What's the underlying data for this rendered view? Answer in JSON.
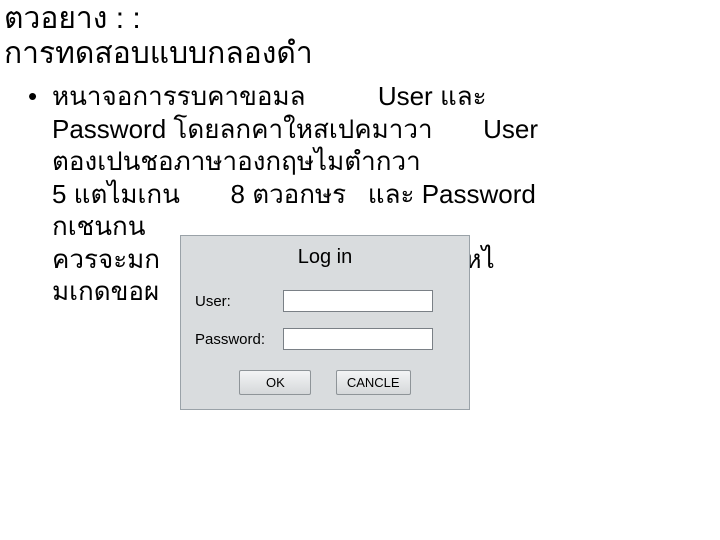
{
  "title": {
    "line1": "ตวอยาง   : :",
    "line2": "การทดสอบแบบกลองดำ"
  },
  "bullet": {
    "line1": "หนาจอการรบคาขอมล          User และ",
    "line2": "Password โดยลกคาใหสเปคมาวา       User",
    "line3": "ตองเปนชอภาษาองกฤษไมตำกวา",
    "line4": "5 แตไมเกน       8 ตวอกษร   และ Password",
    "line5": "กเชนกน",
    "line6": "ควรจะมก                                    ทำใหไ",
    "line7": "มเกดขอผ"
  },
  "login": {
    "title": "Log in",
    "user_label": "User:",
    "password_label": "Password:",
    "ok_label": "OK",
    "cancel_label": "CANCLE"
  }
}
